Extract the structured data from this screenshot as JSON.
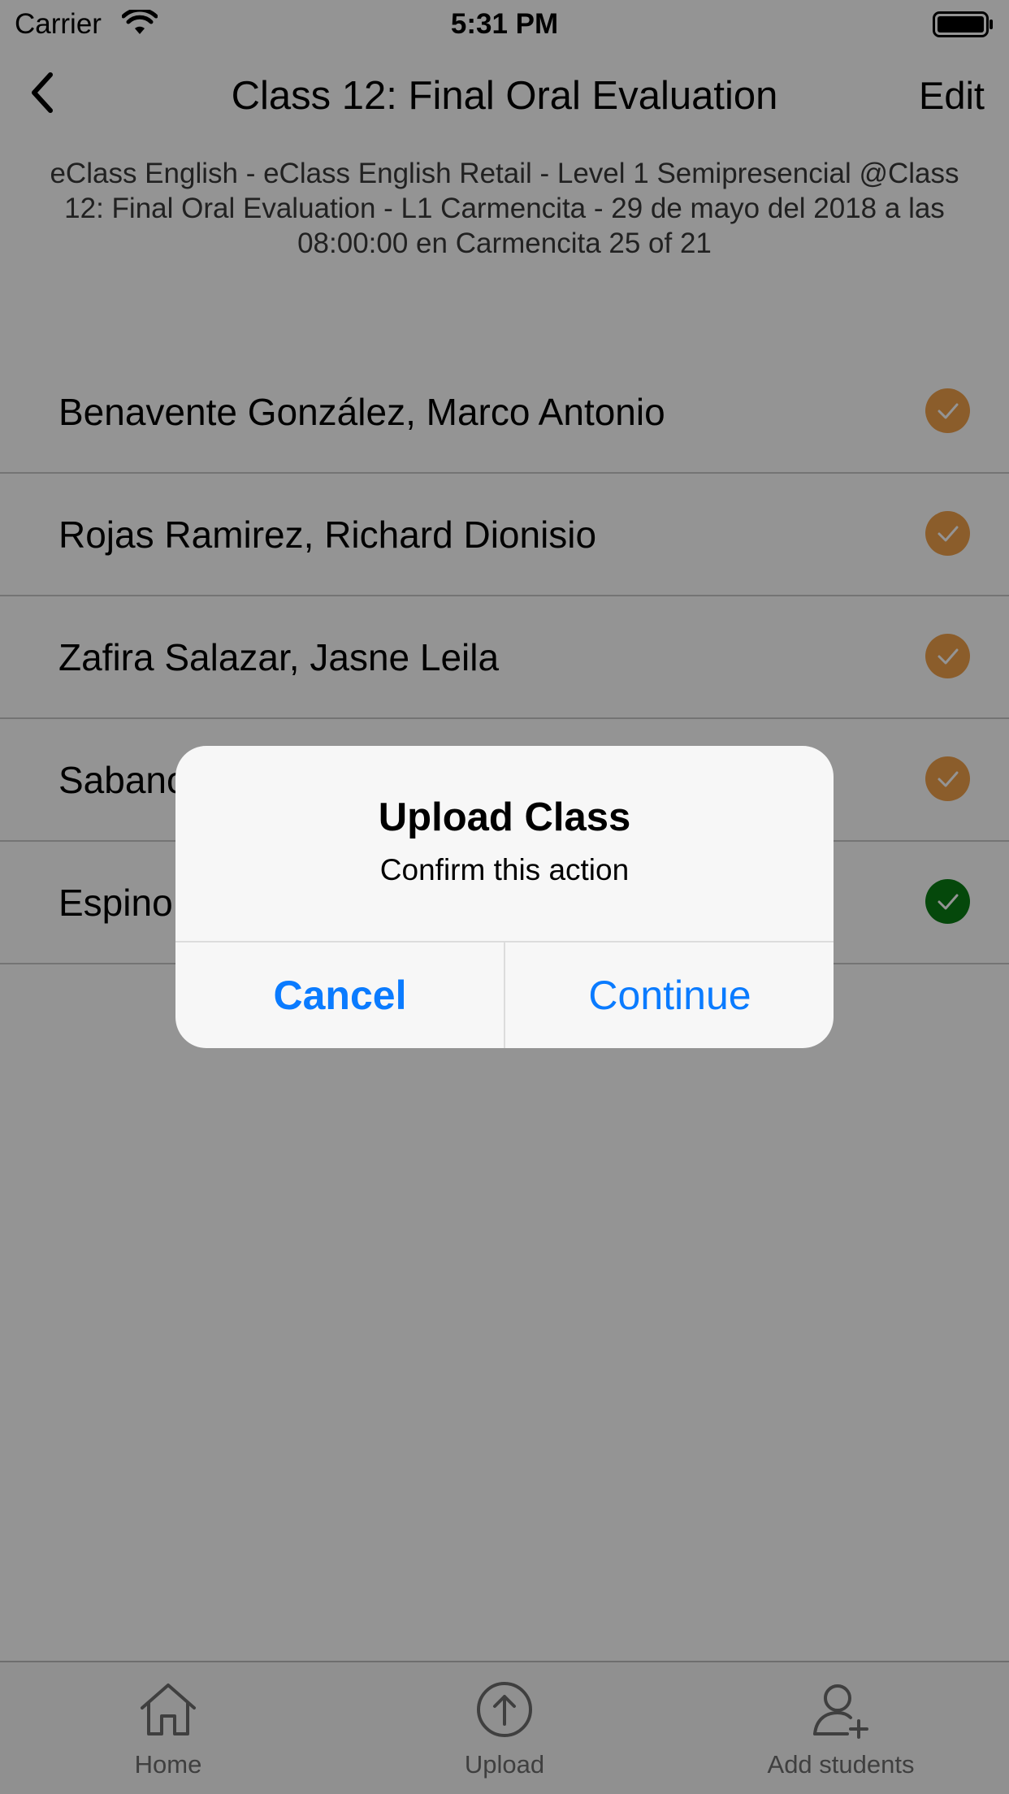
{
  "status_bar": {
    "carrier": "Carrier",
    "time": "5:31 PM"
  },
  "nav": {
    "title": "Class 12: Final Oral Evaluation",
    "edit_label": "Edit"
  },
  "subtitle": "eClass English - eClass English Retail -  Level 1 Semipresencial @Class 12: Final Oral Evaluation - L1 Carmencita - 29 de mayo del 2018 a las 08:00:00 en Carmencita 25 of 21",
  "students": [
    {
      "name": "Benavente González, Marco Antonio",
      "status_color": "#f0a04b"
    },
    {
      "name": "Rojas Ramirez, Richard Dionisio",
      "status_color": "#f0a04b"
    },
    {
      "name": "Zafira Salazar, Jasne Leila",
      "status_color": "#f0a04b"
    },
    {
      "name": "Sabanc",
      "status_color": "#f0a04b"
    },
    {
      "name": "Espino",
      "status_color": "#0a7d14"
    }
  ],
  "tabs": [
    {
      "label": "Home",
      "icon": "home-icon"
    },
    {
      "label": "Upload",
      "icon": "upload-icon"
    },
    {
      "label": "Add students",
      "icon": "add-user-icon"
    }
  ],
  "alert": {
    "title": "Upload Class",
    "message": "Confirm this action",
    "cancel_label": "Cancel",
    "continue_label": "Continue"
  },
  "colors": {
    "accent": "#0a7bff",
    "pending": "#f0a04b",
    "done": "#0a7d14"
  }
}
